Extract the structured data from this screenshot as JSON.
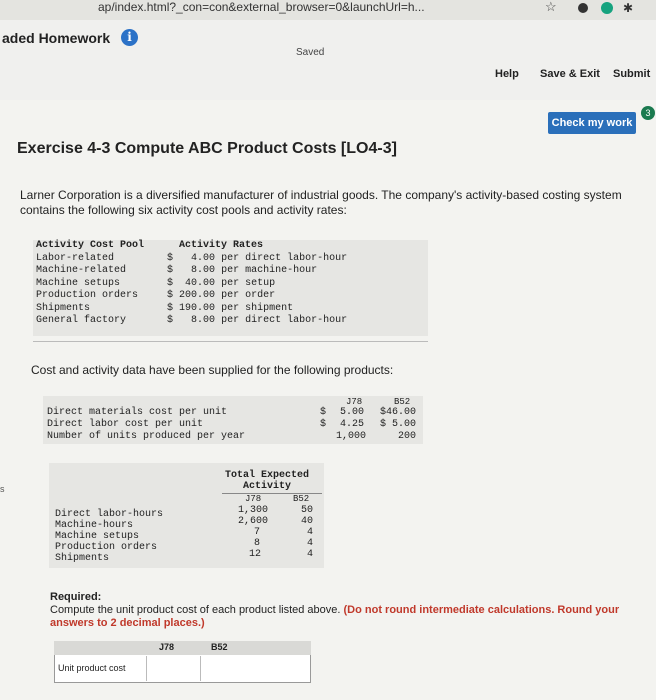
{
  "browser": {
    "url": "ap/index.html?_con=con&external_browser=0&launchUrl=h...",
    "star": "☆"
  },
  "header": {
    "brand": "aded Homework",
    "info": "i",
    "saved": "Saved",
    "help": "Help",
    "save_exit": "Save & Exit",
    "submit": "Submit",
    "check": "Check my work",
    "check_badge": "3"
  },
  "exercise": {
    "title": "Exercise 4-3 Compute ABC Product Costs [LO4-3]",
    "intro": "Larner Corporation is a diversified manufacturer of industrial goods. The company's activity-based costing system contains the following six activity cost pools and activity rates:"
  },
  "rates_table": {
    "headers": [
      "Activity Cost Pool",
      "Activity Rates"
    ],
    "rows": [
      {
        "pool": "Labor-related",
        "sign": "$",
        "rate": "4.00",
        "unit": "per direct labor-hour"
      },
      {
        "pool": "Machine-related",
        "sign": "$",
        "rate": "8.00",
        "unit": "per machine-hour"
      },
      {
        "pool": "Machine setups",
        "sign": "$",
        "rate": "40.00",
        "unit": "per setup"
      },
      {
        "pool": "Production orders",
        "sign": "$",
        "rate": "200.00",
        "unit": "per order"
      },
      {
        "pool": "Shipments",
        "sign": "$",
        "rate": "190.00",
        "unit": "per shipment"
      },
      {
        "pool": "General factory",
        "sign": "$",
        "rate": "8.00",
        "unit": "per direct labor-hour"
      }
    ]
  },
  "cost_intro": "Cost and activity data have been supplied for the following products:",
  "product_table": {
    "headers": [
      "J78",
      "B52"
    ],
    "rows": [
      {
        "label": "Direct materials cost per unit",
        "s1": "$",
        "j78": "5.00",
        "b52": "$46.00"
      },
      {
        "label": "Direct labor cost per unit",
        "s1": "$",
        "j78": "4.25",
        "b52": "$ 5.00"
      },
      {
        "label": "Number of units produced per year",
        "s1": "",
        "j78": "1,000",
        "b52": "200"
      }
    ]
  },
  "activity_table": {
    "title1": "Total Expected",
    "title2": "Activity",
    "headers": [
      "J78",
      "B52"
    ],
    "rows": [
      {
        "label": "Direct labor-hours",
        "j78": "1,300",
        "b52": "50"
      },
      {
        "label": "Machine-hours",
        "j78": "2,600",
        "b52": "40"
      },
      {
        "label": "Machine setups",
        "j78": "7",
        "b52": "4"
      },
      {
        "label": "Production orders",
        "j78": "8",
        "b52": "4"
      },
      {
        "label": "Shipments",
        "j78": "12",
        "b52": "4"
      }
    ]
  },
  "required": {
    "label": "Required:",
    "text": "Compute the unit product cost of each product listed above.",
    "note": "(Do not round intermediate calculations. Round your answers to 2 decimal places.)"
  },
  "answer_table": {
    "headers": [
      "J78",
      "B52"
    ],
    "row_label": "Unit product cost"
  },
  "edge_text": "s"
}
